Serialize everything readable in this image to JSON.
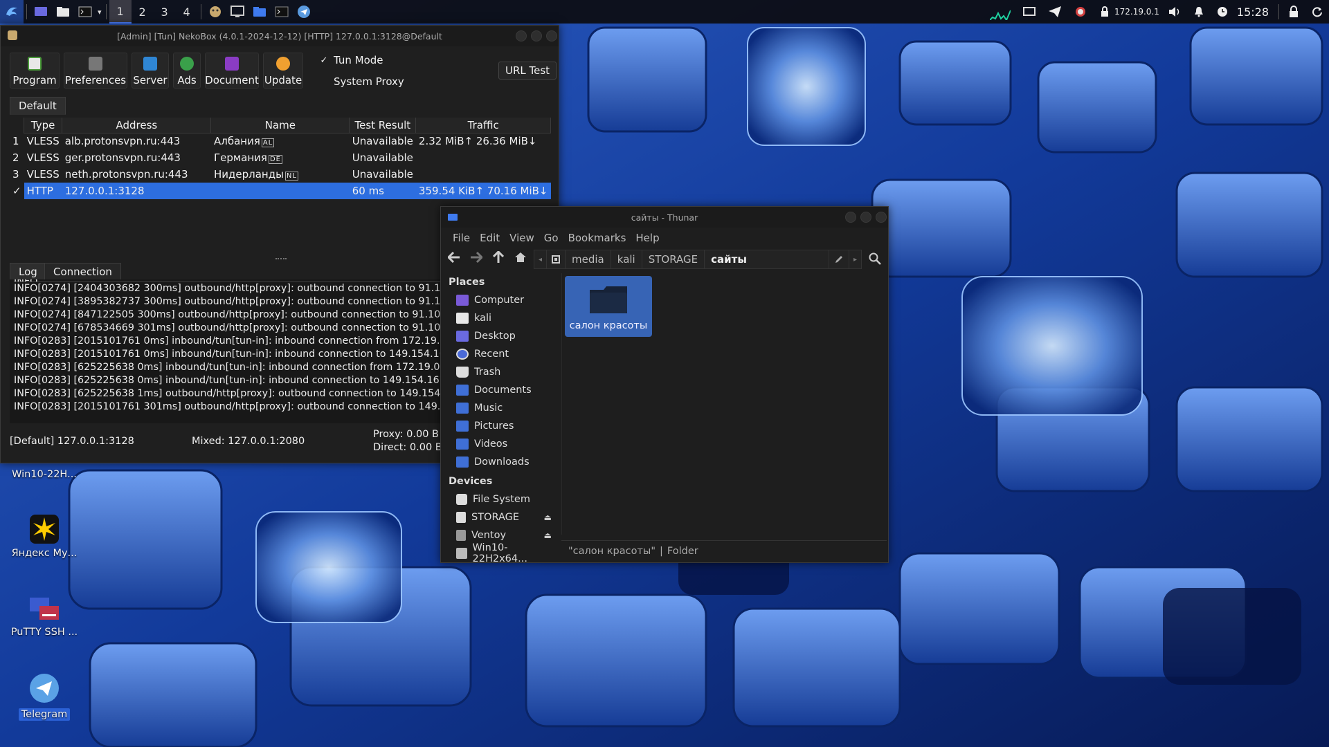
{
  "panel": {
    "workspaces": [
      "1",
      "2",
      "3",
      "4"
    ],
    "active_workspace": "1",
    "ip": "172.19.0.1",
    "clock": "15:28"
  },
  "neko": {
    "title": "[Admin] [Tun] NekoBox (4.0.1-2024-12-12) [HTTP] 127.0.0.1:3128@Default",
    "toolbar": [
      "Program",
      "Preferences",
      "Server",
      "Ads",
      "Document",
      "Update"
    ],
    "tun_mode_label": "Tun Mode",
    "tun_mode_checked": true,
    "system_proxy_label": "System Proxy",
    "system_proxy_checked": false,
    "url_test_label": "URL Test",
    "group_tab": "Default",
    "columns": [
      "Type",
      "Address",
      "Name",
      "Test Result",
      "Traffic"
    ],
    "rows": [
      {
        "num": "1",
        "type": "VLESS",
        "address": "alb.protonsvpn.ru:443",
        "name": "Албания",
        "flag": "AL",
        "result": "Unavailable",
        "traffic": "2.32 MiB↑ 26.36 MiB↓"
      },
      {
        "num": "2",
        "type": "VLESS",
        "address": "ger.protonsvpn.ru:443",
        "name": "Германия",
        "flag": "DE",
        "result": "Unavailable",
        "traffic": ""
      },
      {
        "num": "3",
        "type": "VLESS",
        "address": "neth.protonsvpn.ru:443",
        "name": "Нидерланды",
        "flag": "NL",
        "result": "Unavailable",
        "traffic": ""
      },
      {
        "num": "✓",
        "type": "HTTP",
        "address": "127.0.0.1:3128",
        "name": "",
        "flag": "",
        "result": "60 ms",
        "traffic": "359.54 KiB↑ 70.16 MiB↓"
      }
    ],
    "log_tab": "Log",
    "connection_tab": "Connection",
    "log_lines": [
      "INFO[0274] [2404303682 300ms] outbound/http[proxy]: outbound connection to 91.105.192",
      "INFO[0274] [3895382737 300ms] outbound/http[proxy]: outbound connection to 91.105.192",
      "INFO[0274] [847122505 300ms] outbound/http[proxy]: outbound connection to 91.105.192.1",
      "INFO[0274] [678534669 301ms] outbound/http[proxy]: outbound connection to 91.105.192.1",
      "INFO[0283] [2015101761 0ms] inbound/tun[tun-in]: inbound connection from 172.19.0.1:427",
      "INFO[0283] [2015101761 0ms] inbound/tun[tun-in]: inbound connection to 149.154.167.222:4",
      "INFO[0283] [625225638 0ms] inbound/tun[tun-in]: inbound connection from 172.19.0.1:5258",
      "INFO[0283] [625225638 0ms] inbound/tun[tun-in]: inbound connection to 149.154.167.222:8",
      "INFO[0283] [625225638 1ms] outbound/http[proxy]: outbound connection to 149.154.167.22",
      "INFO[0283] [2015101761 301ms] outbound/http[proxy]: outbound connection to 149.154.167"
    ],
    "status_left": "[Default] 127.0.0.1:3128",
    "status_mixed": "Mixed: 127.0.0.1:2080",
    "status_proxy": "Proxy: 0.00 B↑",
    "status_direct": "Direct: 0.00 B↓"
  },
  "thunar": {
    "title": "сайты - Thunar",
    "menu": [
      "File",
      "Edit",
      "View",
      "Go",
      "Bookmarks",
      "Help"
    ],
    "breadcrumbs": [
      "media",
      "kali",
      "STORAGE",
      "сайты"
    ],
    "places_label": "Places",
    "places": [
      {
        "label": "Computer",
        "icon": "computer-icon",
        "color": "#7a5ad8"
      },
      {
        "label": "kali",
        "icon": "home-folder-icon",
        "color": "#e8e8e8"
      },
      {
        "label": "Desktop",
        "icon": "desktop-icon",
        "color": "#6a6ae0"
      },
      {
        "label": "Recent",
        "icon": "recent-icon",
        "color": "#4a6ad8"
      },
      {
        "label": "Trash",
        "icon": "trash-icon",
        "color": "#dddddd"
      },
      {
        "label": "Documents",
        "icon": "documents-folder-icon",
        "color": "#3f6fd6"
      },
      {
        "label": "Music",
        "icon": "music-folder-icon",
        "color": "#3f6fd6"
      },
      {
        "label": "Pictures",
        "icon": "pictures-folder-icon",
        "color": "#3f6fd6"
      },
      {
        "label": "Videos",
        "icon": "videos-folder-icon",
        "color": "#3f6fd6"
      },
      {
        "label": "Downloads",
        "icon": "downloads-folder-icon",
        "color": "#3f6fd6"
      }
    ],
    "devices_label": "Devices",
    "devices": [
      {
        "label": "File System",
        "icon": "drive-icon",
        "eject": false
      },
      {
        "label": "STORAGE",
        "icon": "usb-drive-icon",
        "eject": true
      },
      {
        "label": "Ventoy",
        "icon": "usb-drive-icon",
        "eject": true
      },
      {
        "label": "Win10-22H2x64...",
        "icon": "disc-icon",
        "eject": false
      }
    ],
    "folder_name": "салон красоты",
    "status_name": "\"салон красоты\"",
    "status_sep": "|",
    "status_type": "Folder"
  },
  "desktop": {
    "icons": [
      {
        "label": "Win10-22H...",
        "icon": "disc-image-icon"
      },
      {
        "label": "Яндекс Му...",
        "icon": "yandex-music-icon"
      },
      {
        "label": "PuTTY SSH ...",
        "icon": "putty-icon"
      },
      {
        "label": "Telegram",
        "icon": "telegram-icon"
      }
    ]
  }
}
